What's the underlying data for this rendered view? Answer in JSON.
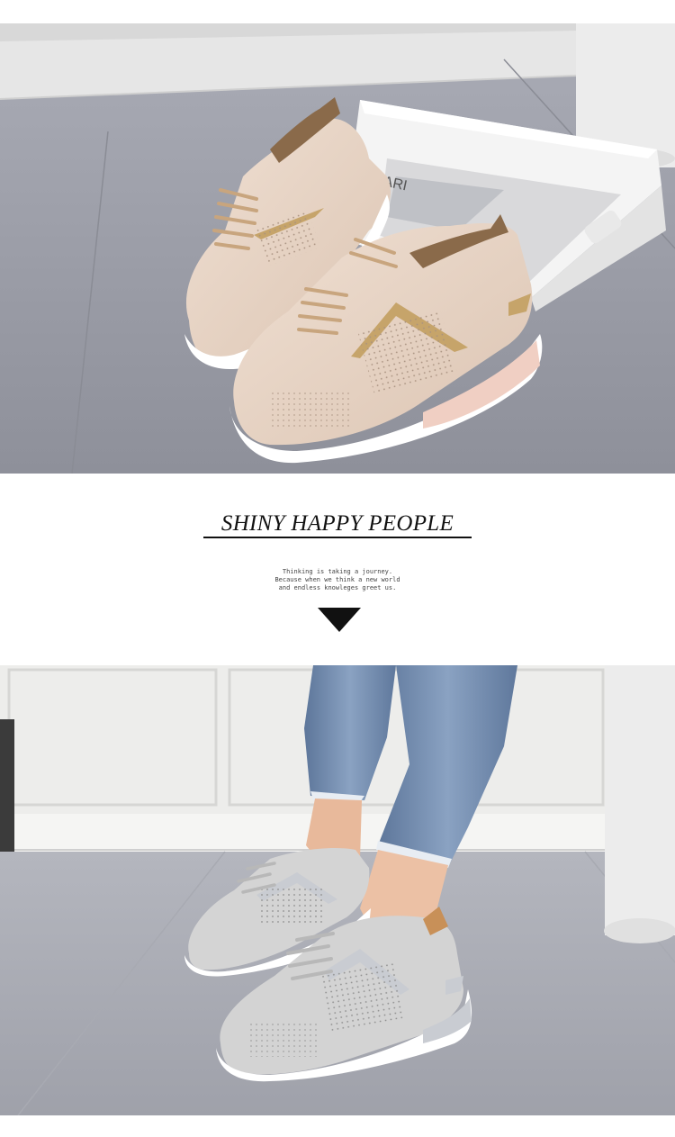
{
  "headline": "SHINY HAPPY PEOPLE",
  "blurb_lines": [
    "Thinking is taking a journey.",
    "Because when we think a new world",
    "and endless knowleges greet us."
  ],
  "box_print_text": "ARI",
  "colors": {
    "page_background": "#ffffff",
    "floor_gray": "#9a9ca6",
    "wall_white": "#eeeeec",
    "shoe_beige": "#ead7c8",
    "shoe_gray": "#d4d4d4",
    "accent_gold": "#c6a46a",
    "accent_silver": "#c9ccd2",
    "denim": "#6f88a8"
  },
  "icons": [
    "down-triangle-icon"
  ]
}
